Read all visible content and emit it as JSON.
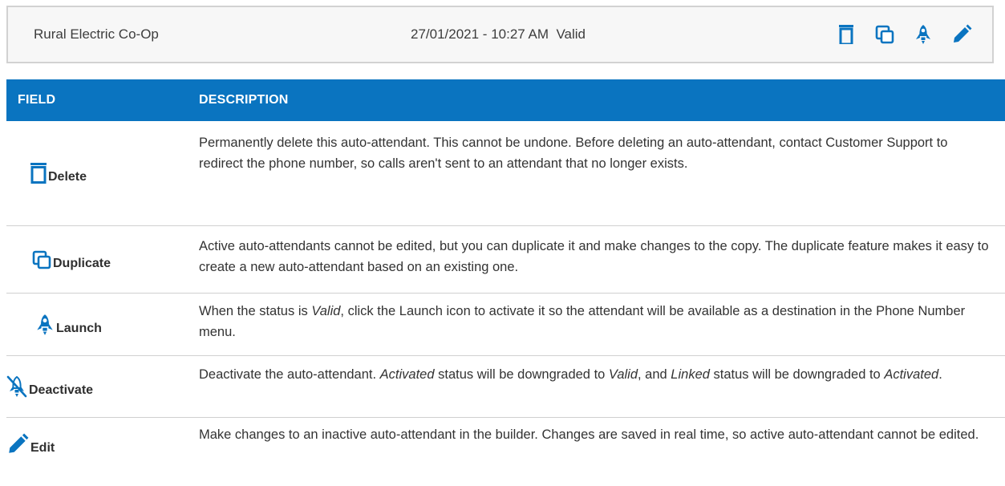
{
  "attendant": {
    "name": "Rural Electric Co-Op",
    "datetime_status": "27/01/2021 - 10:27 AM  Valid",
    "actions": [
      {
        "icon": "delete-icon"
      },
      {
        "icon": "duplicate-icon"
      },
      {
        "icon": "launch-icon"
      },
      {
        "icon": "edit-icon"
      }
    ]
  },
  "colors": {
    "accent": "#0a74c0",
    "header_text": "#ffffff",
    "icon": "#0a74c0"
  },
  "table": {
    "headers": {
      "field": "FIELD",
      "description": "DESCRIPTION"
    },
    "rows": [
      {
        "field": "Delete",
        "icon": "delete-icon",
        "description": [
          {
            "text": "Permanently delete this auto-attendant. This cannot be undone. Before deleting an auto-attendant, contact Customer Support to redirect the phone number, so calls aren't sent to an attendant that no longer exists."
          }
        ]
      },
      {
        "field": "Duplicate",
        "icon": "duplicate-icon",
        "description": [
          {
            "text": "Active auto-attendants cannot be edited, but you can duplicate it and make changes to the copy. The duplicate feature makes it easy to create a new auto-attendant based on an existing one."
          }
        ]
      },
      {
        "field": "Launch",
        "icon": "launch-icon",
        "description": [
          {
            "text": "When the status is "
          },
          {
            "text": "Valid",
            "italic": true
          },
          {
            "text": ", click the Launch icon to activate it so the attendant will be available as a destination in the Phone Number menu."
          }
        ]
      },
      {
        "field": "Deactivate",
        "icon": "deactivate-icon",
        "description": [
          {
            "text": "Deactivate the auto-attendant. "
          },
          {
            "text": "Activated",
            "italic": true
          },
          {
            "text": " status will be downgraded to "
          },
          {
            "text": "Valid",
            "italic": true
          },
          {
            "text": ", and "
          },
          {
            "text": "Linked",
            "italic": true
          },
          {
            "text": " status will be downgraded to "
          },
          {
            "text": "Activated",
            "italic": true
          },
          {
            "text": "."
          }
        ]
      },
      {
        "field": "Edit",
        "icon": "edit-icon",
        "description": [
          {
            "text": "Make changes to an inactive auto-attendant in the builder. Changes are saved in real time, so active auto-attendant cannot be edited."
          }
        ]
      }
    ]
  }
}
